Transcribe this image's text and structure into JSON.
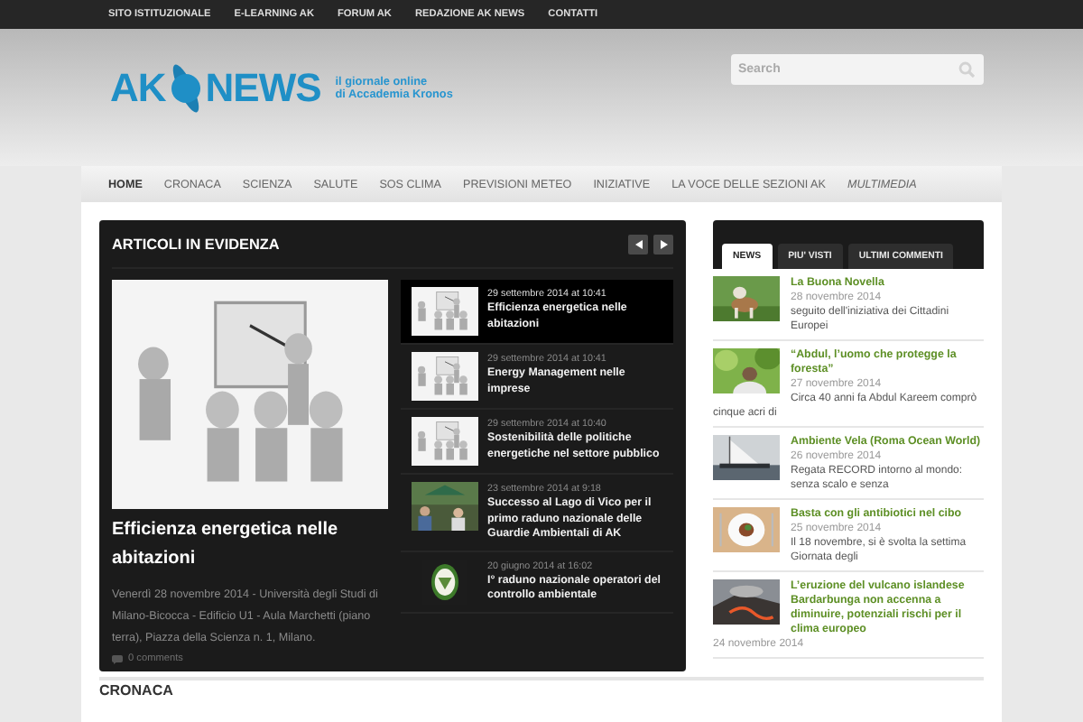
{
  "top_links": [
    "SITO ISTITUZIONALE",
    "E-LEARNING AK",
    "FORUM AK",
    "REDAZIONE AK NEWS",
    "CONTATTI"
  ],
  "header": {
    "logo": {
      "left": "AK",
      "right": "NEWS",
      "tagline": [
        "il giornale online",
        "di Accademia Kronos"
      ]
    },
    "search": {
      "placeholder": "Search"
    }
  },
  "nav": [
    {
      "label": "HOME",
      "selected": true,
      "italic": false
    },
    {
      "label": "CRONACA",
      "selected": false,
      "italic": false
    },
    {
      "label": "SCIENZA",
      "selected": false,
      "italic": false
    },
    {
      "label": "SALUTE",
      "selected": false,
      "italic": false
    },
    {
      "label": "SOS CLIMA",
      "selected": false,
      "italic": false
    },
    {
      "label": "PREVISIONI METEO",
      "selected": false,
      "italic": false
    },
    {
      "label": "INIZIATIVE",
      "selected": false,
      "italic": false
    },
    {
      "label": "LA VOCE DELLE SEZIONI AK",
      "selected": false,
      "italic": false
    },
    {
      "label": "MULTIMEDIA",
      "selected": false,
      "italic": true
    }
  ],
  "featured": {
    "title": "ARTICOLI IN EVIDENZA",
    "main": {
      "title": "Efficienza energetica nelle abitazioni",
      "description": "Venerdì 28 novembre 2014 - Università degli Studi di Milano-Bicocca - Edificio U1 - Aula Marchetti (piano terra), Piazza della Scienza n. 1, Milano.",
      "comments": "0 comments"
    },
    "items": [
      {
        "date": "29 settembre 2014 at 10:41",
        "title": "Efficienza energetica nelle abitazioni",
        "selected": true
      },
      {
        "date": "29 settembre 2014 at 10:41",
        "title": "Energy Management nelle imprese",
        "selected": false
      },
      {
        "date": "29 settembre 2014 at 10:40",
        "title": "Sostenibilità delle politiche energetiche nel settore pubblico",
        "selected": false
      },
      {
        "date": "23 settembre 2014 at 9:18",
        "title": "Successo al Lago di Vico per il primo raduno nazionale delle Guardie Ambientali di AK",
        "selected": false
      },
      {
        "date": "20 giugno 2014 at 16:02",
        "title": "I° raduno nazionale operatori del controllo ambientale",
        "selected": false
      }
    ]
  },
  "sidebar": {
    "tabs": [
      {
        "label": "NEWS",
        "selected": true
      },
      {
        "label": "PIU' VISTI",
        "selected": false
      },
      {
        "label": "ULTIMI COMMENTI",
        "selected": false
      }
    ],
    "items": [
      {
        "title": "La Buona Novella",
        "date": "28 novembre 2014",
        "excerpt": "seguito dell'iniziativa dei Cittadini Europei"
      },
      {
        "title": "“Abdul, l’uomo che protegge la foresta”",
        "date": "27 novembre 2014",
        "excerpt": "Circa 40 anni fa Abdul Kareem comprò cinque acri di"
      },
      {
        "title": "Ambiente Vela (Roma Ocean World)",
        "date": "26 novembre 2014",
        "excerpt": "Regata RECORD intorno al mondo: senza scalo e senza"
      },
      {
        "title": "Basta con gli antibiotici nel cibo",
        "date": "25 novembre 2014",
        "excerpt": "Il 18 novembre, si è svolta la settima Giornata degli"
      },
      {
        "title": "L’eruzione del vulcano islandese Bardarbunga non accenna a diminuire, potenziali rischi per il clima europeo",
        "date": "24 novembre 2014"
      }
    ]
  },
  "section": {
    "title": "CRONACA"
  }
}
